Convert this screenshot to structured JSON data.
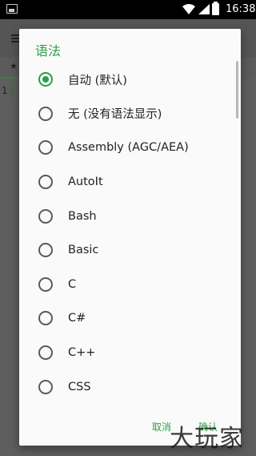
{
  "status_bar": {
    "time": "16:38",
    "icons": [
      "image-icon",
      "wifi-icon",
      "signal-icon",
      "battery-charging-icon"
    ]
  },
  "background_app": {
    "tab_star": "★",
    "line_number": "1"
  },
  "dialog": {
    "title": "语法",
    "options": [
      {
        "label": "自动 (默认)",
        "selected": true
      },
      {
        "label": "无 (没有语法显示)",
        "selected": false
      },
      {
        "label": "Assembly (AGC/AEA)",
        "selected": false
      },
      {
        "label": "AutoIt",
        "selected": false
      },
      {
        "label": "Bash",
        "selected": false
      },
      {
        "label": "Basic",
        "selected": false
      },
      {
        "label": "C",
        "selected": false
      },
      {
        "label": "C#",
        "selected": false
      },
      {
        "label": "C++",
        "selected": false
      },
      {
        "label": "CSS",
        "selected": false
      }
    ],
    "cancel_label": "取消",
    "ok_label": "确认"
  },
  "watermark": "大玩家",
  "colors": {
    "accent": "#2e9e48",
    "scrim": "#616161"
  }
}
